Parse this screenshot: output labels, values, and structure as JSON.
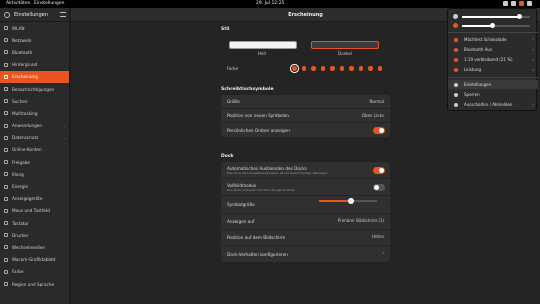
{
  "topbar": {
    "activities": "Aktivitäten",
    "app_name": "Einstellungen",
    "clock": "29. Jul 12:25"
  },
  "sidebar": {
    "title": "Einstellungen",
    "items": [
      {
        "label": "WLAN",
        "icon": "wifi-icon"
      },
      {
        "label": "Netzwerk",
        "icon": "network-icon"
      },
      {
        "label": "Bluetooth",
        "icon": "bluetooth-icon"
      },
      {
        "label": "Hintergrund",
        "icon": "background-icon"
      },
      {
        "label": "Erscheinung",
        "icon": "appearance-icon"
      },
      {
        "label": "Benachrichtigungen",
        "icon": "bell-icon"
      },
      {
        "label": "Suchen",
        "icon": "search-icon"
      },
      {
        "label": "Multitasking",
        "icon": "multitasking-icon"
      },
      {
        "label": "Anwendungen",
        "icon": "apps-icon"
      },
      {
        "label": "Datenschutz",
        "icon": "privacy-icon"
      },
      {
        "label": "Online-Konten",
        "icon": "cloud-icon"
      },
      {
        "label": "Freigabe",
        "icon": "share-icon"
      },
      {
        "label": "Klang",
        "icon": "speaker-icon"
      },
      {
        "label": "Energie",
        "icon": "power-icon"
      },
      {
        "label": "Anzeigegeräte",
        "icon": "display-icon"
      },
      {
        "label": "Maus und Tastfeld",
        "icon": "mouse-icon"
      },
      {
        "label": "Tastatur",
        "icon": "keyboard-icon"
      },
      {
        "label": "Drucker",
        "icon": "printer-icon"
      },
      {
        "label": "Wechselmedien",
        "icon": "media-icon"
      },
      {
        "label": "Wacom-Grafiktablett",
        "icon": "tablet-icon"
      },
      {
        "label": "Farbe",
        "icon": "color-icon"
      },
      {
        "label": "Region und Sprache",
        "icon": "region-icon"
      }
    ],
    "active_index": 4,
    "expandable_indices": [
      8,
      9
    ]
  },
  "main": {
    "title": "Erscheinung",
    "style_section": "Stil",
    "style_light": "Hell",
    "style_dark": "Dunkel",
    "color_label": "Farbe",
    "color_count": 10,
    "selected_color": 0,
    "accent": "#e95420",
    "desktop_icons_section": "Schreibtischsymbole",
    "size_label": "Größe",
    "size_value": "Normal",
    "position_new_icons_label": "Position von neuen Symbolen",
    "position_new_icons_value": "Oben Links",
    "show_personal_folder_label": "Persönlichen Ordner anzeigen",
    "show_personal_folder": true,
    "dock_section": "Dock",
    "auto_hide_label": "Automatisches Ausblenden des Docks",
    "auto_hide_sub": "Das Dock wird ausgeblendet wenn es mit einem Fenster überlappt.",
    "auto_hide": true,
    "panel_mode_label": "Vollbildmodus",
    "panel_mode_sub": "Das Dock erstreckt sich über die ganze Höhe.",
    "panel_mode": false,
    "icon_size_label": "Symbolgröße",
    "icon_size_level": 0.55,
    "show_on_label": "Anzeigen auf",
    "show_on_value": "Primärer Bildschirm (1)",
    "screen_position_label": "Position auf dem Bildschirm",
    "screen_position_value": "Unten",
    "dock_behavior_label": "Dock-Verhalten konfigurieren"
  },
  "quick_settings": {
    "volume_level": 0.85,
    "brightness_level": 0.45,
    "items": [
      {
        "label": "Möchtest Schokolade",
        "chev": "›"
      },
      {
        "label": "Bluetooth Aus",
        "chev": "›"
      },
      {
        "label": "1:19 verbleibend (21 %)",
        "chev": "›"
      },
      {
        "label": "Leistung",
        "chev": "›"
      }
    ],
    "actions": [
      {
        "label": "Einstellungen"
      },
      {
        "label": "Sperren"
      },
      {
        "label": "Ausschalten / Abmelden",
        "chev": "›"
      }
    ]
  }
}
